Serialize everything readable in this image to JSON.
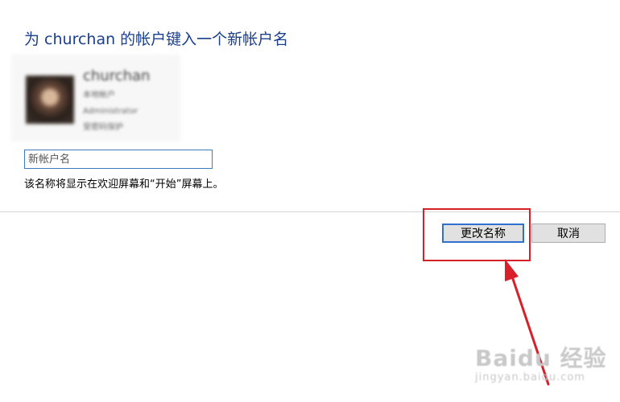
{
  "dialog": {
    "heading": "为 churchan 的帐户键入一个新帐户名",
    "account": {
      "name": "churchan",
      "lines": [
        "本地帐户",
        "Administrator",
        "受密码保护"
      ]
    },
    "name_field": {
      "value": "",
      "placeholder": "新帐户名"
    },
    "hint": "该名称将显示在欢迎屏幕和“开始”屏幕上。",
    "buttons": {
      "change_name": "更改名称",
      "cancel": "取消"
    }
  },
  "annotation": {
    "color": "#d8202a"
  },
  "watermark": {
    "main": "Baidu 经验",
    "sub": "jingyan.baidu.com"
  },
  "colors": {
    "heading": "#1a3f8f",
    "focus_border": "#2e6fcf",
    "button_bg": "#e1e1e1"
  }
}
